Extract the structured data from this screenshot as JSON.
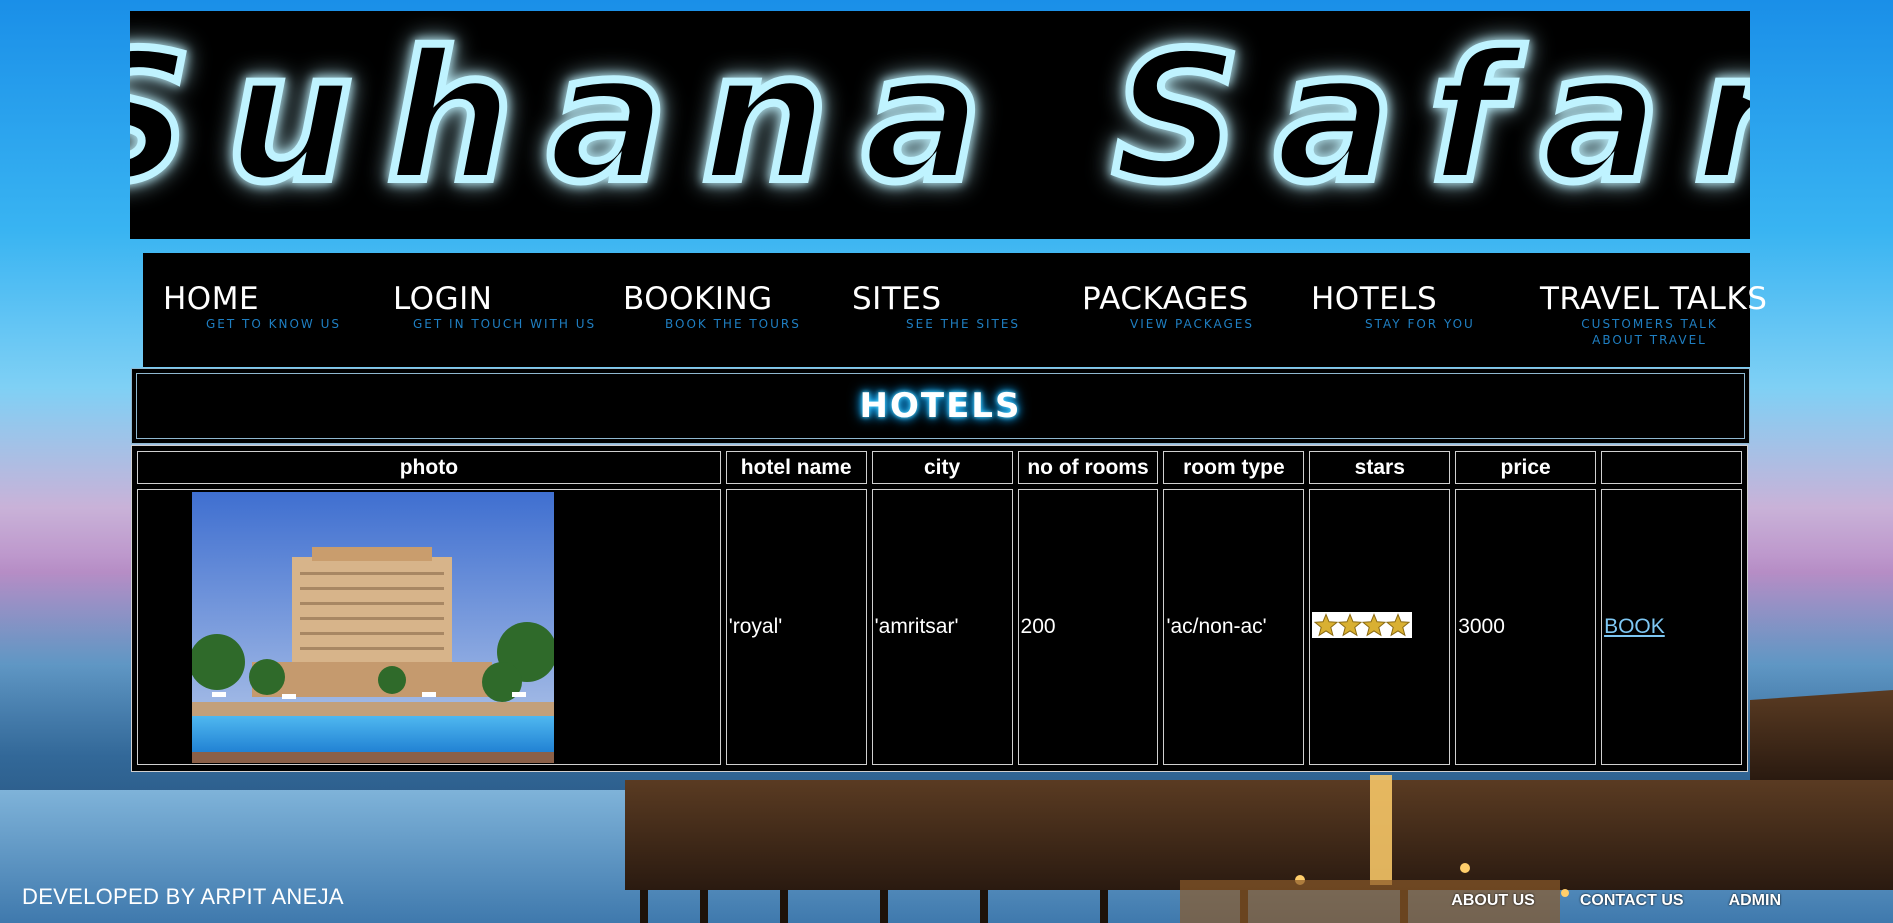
{
  "banner": {
    "logo_text": "Suhana Safar",
    "glow_color": "#22c3ff"
  },
  "nav": [
    {
      "title": "HOME",
      "subtitle": "GET TO KNOW US"
    },
    {
      "title": "LOGIN",
      "subtitle": "GET IN TOUCH WITH US"
    },
    {
      "title": "BOOKING",
      "subtitle": "BOOK THE TOURS"
    },
    {
      "title": "SITES",
      "subtitle": "SEE THE SITES"
    },
    {
      "title": "PACKAGES",
      "subtitle": "VIEW PACKAGES"
    },
    {
      "title": "HOTELS",
      "subtitle": "STAY FOR YOU"
    },
    {
      "title": "TRAVEL TALKS",
      "subtitle": "CUSTOMERS TALK ABOUT TRAVEL"
    }
  ],
  "section_title": "HOTELS",
  "table": {
    "headers": [
      "photo",
      "hotel name",
      "city",
      "no of rooms",
      "room type",
      "stars",
      "price",
      ""
    ],
    "rows": [
      {
        "photo_icon": "hotel-photo",
        "hotel_name": "'royal'",
        "city": "'amritsar'",
        "rooms": "200",
        "room_type": "'ac/non-ac'",
        "stars": 4,
        "price": "3000",
        "action": "BOOK"
      }
    ]
  },
  "footer": {
    "developer": "DEVELOPED BY ARPIT ANEJA",
    "links": [
      "ABOUT US",
      "CONTACT US",
      "ADMIN"
    ]
  },
  "colors": {
    "accent": "#22c3ff",
    "nav_subtitle": "#1f7fc2",
    "link": "#7ec7f3"
  }
}
